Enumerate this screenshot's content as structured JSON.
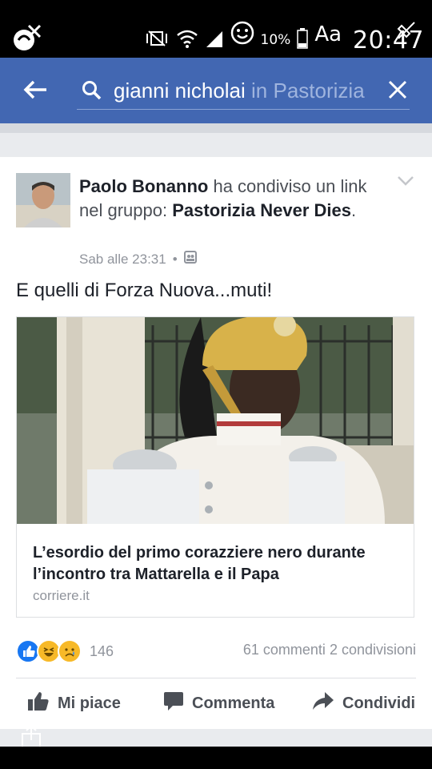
{
  "status_bar": {
    "battery_percent": "10%",
    "font_toggle": "Aa",
    "time": "20:47",
    "icons": [
      "missed-call-icon",
      "vibrate-icon",
      "wifi-icon",
      "signal-icon",
      "smiley-icon",
      "battery-icon",
      "mute-icon"
    ]
  },
  "search": {
    "query": "gianni nicholai",
    "scope": "in Pastorizia",
    "icons": [
      "back-arrow-icon",
      "search-icon",
      "clear-icon"
    ]
  },
  "post": {
    "author": "Paolo Bonanno",
    "action": "ha condiviso un link nel gruppo:",
    "group": "Pastorizia Never Dies",
    "time": "Sab alle 23:31",
    "separator": "•",
    "text": "E quelli di Forza Nuova...muti!",
    "card": {
      "title": "L’esordio del primo corazziere nero durante l’incontro tra Mattarella e il Papa",
      "domain": "corriere.it"
    },
    "reactions": {
      "types": [
        "like",
        "haha",
        "sad"
      ],
      "count": "146",
      "colors": {
        "like": "#1877f2",
        "haha": "#f7b928",
        "sad": "#f7b928"
      }
    },
    "comments": "61 commenti",
    "shares": "2 condivisioni",
    "actions": {
      "like": "Mi piace",
      "comment": "Commenta",
      "share": "Condividi"
    }
  },
  "colors": {
    "header_blue": "#4267b2",
    "text_dark": "#1d2129",
    "text_muted": "#90949c"
  }
}
